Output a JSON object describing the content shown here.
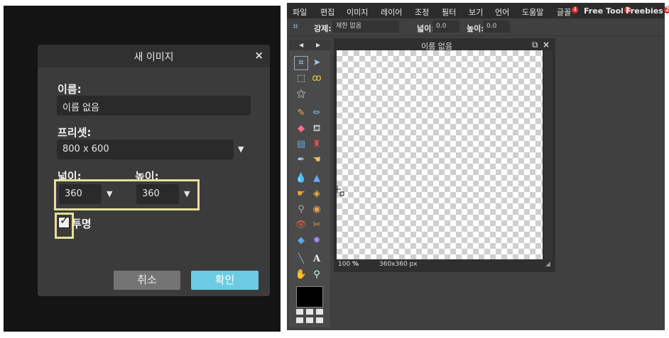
{
  "dialog": {
    "title": "새 이미지",
    "close_glyph": "×",
    "name_label": "이름:",
    "name_value": "이름 없음",
    "preset_label": "프리셋:",
    "preset_value": "800 x 600",
    "width_label": "넓이:",
    "height_label": "높이:",
    "width_value": "360",
    "height_value": "360",
    "transparent_label": "투명",
    "transparent_checked": true,
    "cancel_label": "취소",
    "ok_label": "확인",
    "highlight_color": "#e3e09a"
  },
  "menubar": {
    "items": [
      {
        "label": "파일"
      },
      {
        "label": "편집"
      },
      {
        "label": "이미지"
      },
      {
        "label": "레이어"
      },
      {
        "label": "조정"
      },
      {
        "label": "필터"
      },
      {
        "label": "보기"
      },
      {
        "label": "언어"
      },
      {
        "label": "도움말"
      },
      {
        "label": "글꼴",
        "badge": "4"
      },
      {
        "label": "Free Tool",
        "badge": "1"
      },
      {
        "label": "Freebies",
        "badge": "2"
      }
    ]
  },
  "options": {
    "constraint_label": "강제:",
    "constraint_value": "제한 없음",
    "width_label": "넓이:",
    "width_value": "0.0",
    "height_label": "높이:",
    "height_value": "0.0"
  },
  "document": {
    "title": "이름 없음",
    "zoom": "100",
    "zoom_unit": "%",
    "size": "360x360 px"
  },
  "colors": {
    "accent": "#6ccbe3",
    "foreground": "#000000"
  },
  "icons": [
    "crop-icon",
    "move-icon",
    "marquee-icon",
    "lasso-icon",
    "magic-wand-icon",
    "pencil-icon",
    "brush-icon",
    "eraser-icon",
    "paint-bucket-icon",
    "gradient-icon",
    "stamp-icon",
    "color-picker-icon",
    "smudge-icon",
    "blur-icon",
    "sharpen-icon",
    "dodge-icon",
    "burn-icon",
    "sponge-icon",
    "red-eye-icon",
    "bloat-icon",
    "pinch-icon",
    "type-icon",
    "hand-icon",
    "zoom-icon"
  ]
}
